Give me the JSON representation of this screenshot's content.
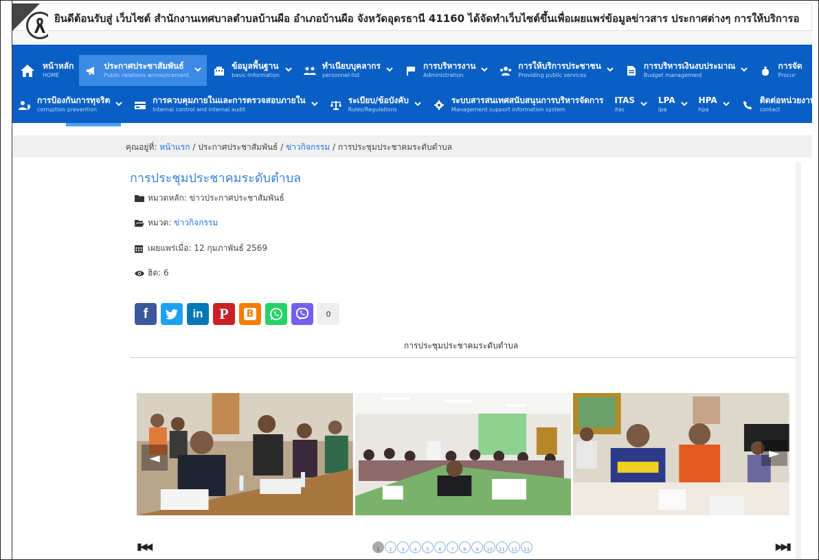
{
  "announcement": "ยินดีต้อนรับสู่ เว็บไซต์ สำนักงานเทศบาลตำบลบ้านผือ อำเภอบ้านผือ จังหวัดอุดรธานี 41160 ได้จัดทำเว็บไซต์ขึ้นเพื่อเผยแพร่ข้อมูลข่าวสาร ประกาศต่างๆ การให้บริการอ",
  "nav_row1": [
    {
      "th": "หน้าหลัก",
      "en": "HOME",
      "icon": "home-icon",
      "dropdown": false
    },
    {
      "th": "ประกาศประชาสัมพันธ์",
      "en": "Public relations announcement",
      "icon": "megaphone-icon",
      "dropdown": true,
      "active": true
    },
    {
      "th": "ข้อมูลพื้นฐาน",
      "en": "basic-information",
      "icon": "building-icon",
      "dropdown": true
    },
    {
      "th": "ทำเนียบบุคลากร",
      "en": "personnel-list",
      "icon": "users-icon",
      "dropdown": true
    },
    {
      "th": "การบริหารงาน",
      "en": "Administration",
      "icon": "flag-icon",
      "dropdown": true
    },
    {
      "th": "การให้บริการประชาชน",
      "en": "Providing public services",
      "icon": "people-icon",
      "dropdown": true
    },
    {
      "th": "การบริหารเงินงบประมาณ",
      "en": "Budget management",
      "icon": "document-icon",
      "dropdown": true
    },
    {
      "th": "การจัด",
      "en": "Procur",
      "icon": "moneybag-icon",
      "dropdown": false
    }
  ],
  "nav_row2": [
    {
      "th": "การป้องกันการทุจริต",
      "en": "corruption prevention",
      "icon": "user-shield-icon",
      "dropdown": true
    },
    {
      "th": "การควบคุมภายในและการตรวจสอบภายใน",
      "en": "Internal control and internal audit",
      "icon": "card-icon",
      "dropdown": true
    },
    {
      "th": "ระเบียบ/ข้อบังคับ",
      "en": "Rules/Regulations",
      "icon": "scale-icon",
      "dropdown": true
    },
    {
      "th": "ระบบสารสนเทศสนับสนุนการบริหารจัดการ",
      "en": "Management support information system",
      "icon": "gear-icon",
      "dropdown": false
    },
    {
      "th": "ITAS",
      "en": "itas",
      "icon": "",
      "dropdown": true
    },
    {
      "th": "LPA",
      "en": "lpa",
      "icon": "",
      "dropdown": true
    },
    {
      "th": "HPA",
      "en": "hpa",
      "icon": "",
      "dropdown": true
    },
    {
      "th": "ติดต่อหน่วยงาน",
      "en": "contact",
      "icon": "phone-icon",
      "dropdown": false
    }
  ],
  "breadcrumb": {
    "prefix": "คุณอยู่ที่:",
    "home": "หน้าแรก",
    "sep": "/",
    "level1": "ประกาศประชาสัมพันธ์",
    "level2": "ข่าวกิจกรรม",
    "current": "การประชุมประชาคมระดับตำบล"
  },
  "article": {
    "title": "การประชุมประชาคมระดับตำบล",
    "main_category_label": "หมวดหลัก:",
    "main_category": "ข่าวประกาศประชาสัมพันธ์",
    "category_label": "หมวด:",
    "category": "ข่าวกิจกรรม",
    "published": "เผยแพร่เมื่อ: 12 กุมภาพันธ์ 2569",
    "hits": "ฮิต: 6",
    "share_count": "0",
    "caption": "การประชุมประชาคมระดับตำบล"
  },
  "gallery": {
    "prev_label": "◄",
    "next_label": "►",
    "first_label": "⏮",
    "last_label": "⏭",
    "pages": [
      "1",
      "2",
      "3",
      "4",
      "5",
      "6",
      "7",
      "8",
      "9",
      "10",
      "11",
      "12",
      "13"
    ],
    "active_page": 1
  },
  "colors": {
    "nav": "#0a5fc4",
    "link": "#1a73e8",
    "title": "#3b7dd8"
  }
}
